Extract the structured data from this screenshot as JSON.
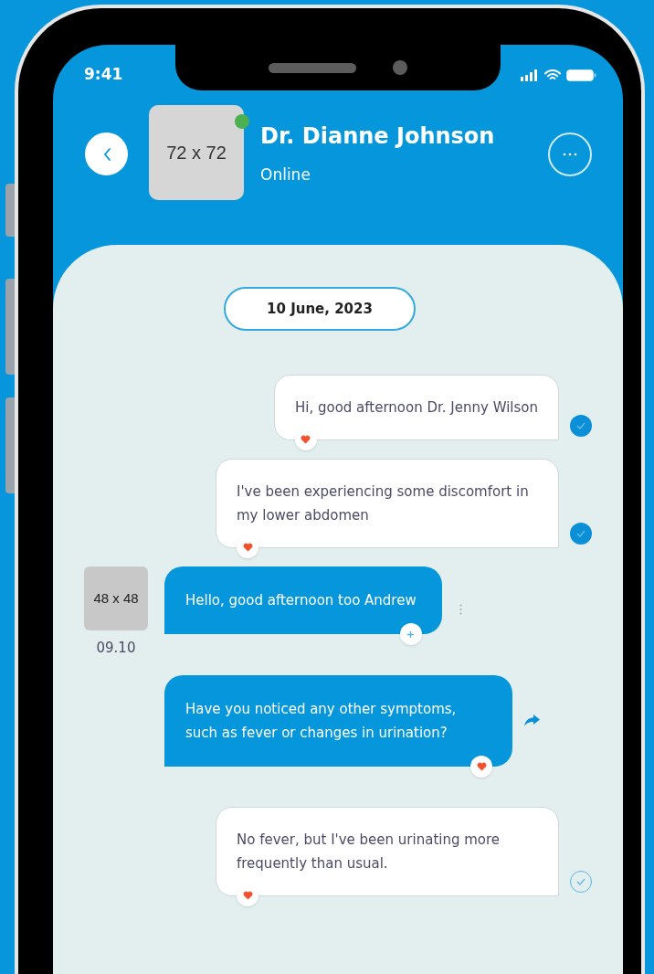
{
  "status_bar": {
    "time": "9:41"
  },
  "header": {
    "avatar": "72 x 72",
    "online": true,
    "name": "Dr. Dianne Johnson",
    "status": "Online"
  },
  "date": "10 June, 2023",
  "messages": [
    {
      "kind": "sent",
      "text": "Hi, good afternoon Dr. Jenny Wilson",
      "receipt": {
        "kind": "read"
      },
      "reaction": {
        "kind": "heart"
      }
    },
    {
      "kind": "sent",
      "text": "I've been experiencing some discomfort in my lower abdomen",
      "receipt": {
        "kind": "read"
      },
      "reaction": {
        "kind": "heart"
      }
    },
    {
      "kind": "received",
      "avatar": "48 x 48",
      "time": "09.10",
      "text": "Hello, good afternoon too Andrew",
      "action": {
        "kind": "more"
      },
      "reaction": {
        "kind": "add"
      }
    },
    {
      "kind": "received",
      "text": "Have you noticed any other symptoms, such as fever or changes in urination?",
      "action": {
        "kind": "forward"
      },
      "reaction": {
        "kind": "heart"
      }
    },
    {
      "kind": "sent",
      "text": "No fever, but I've been urinating more frequently than usual.",
      "receipt": {
        "kind": "delivered"
      },
      "reaction": {
        "kind": "heart"
      }
    }
  ]
}
